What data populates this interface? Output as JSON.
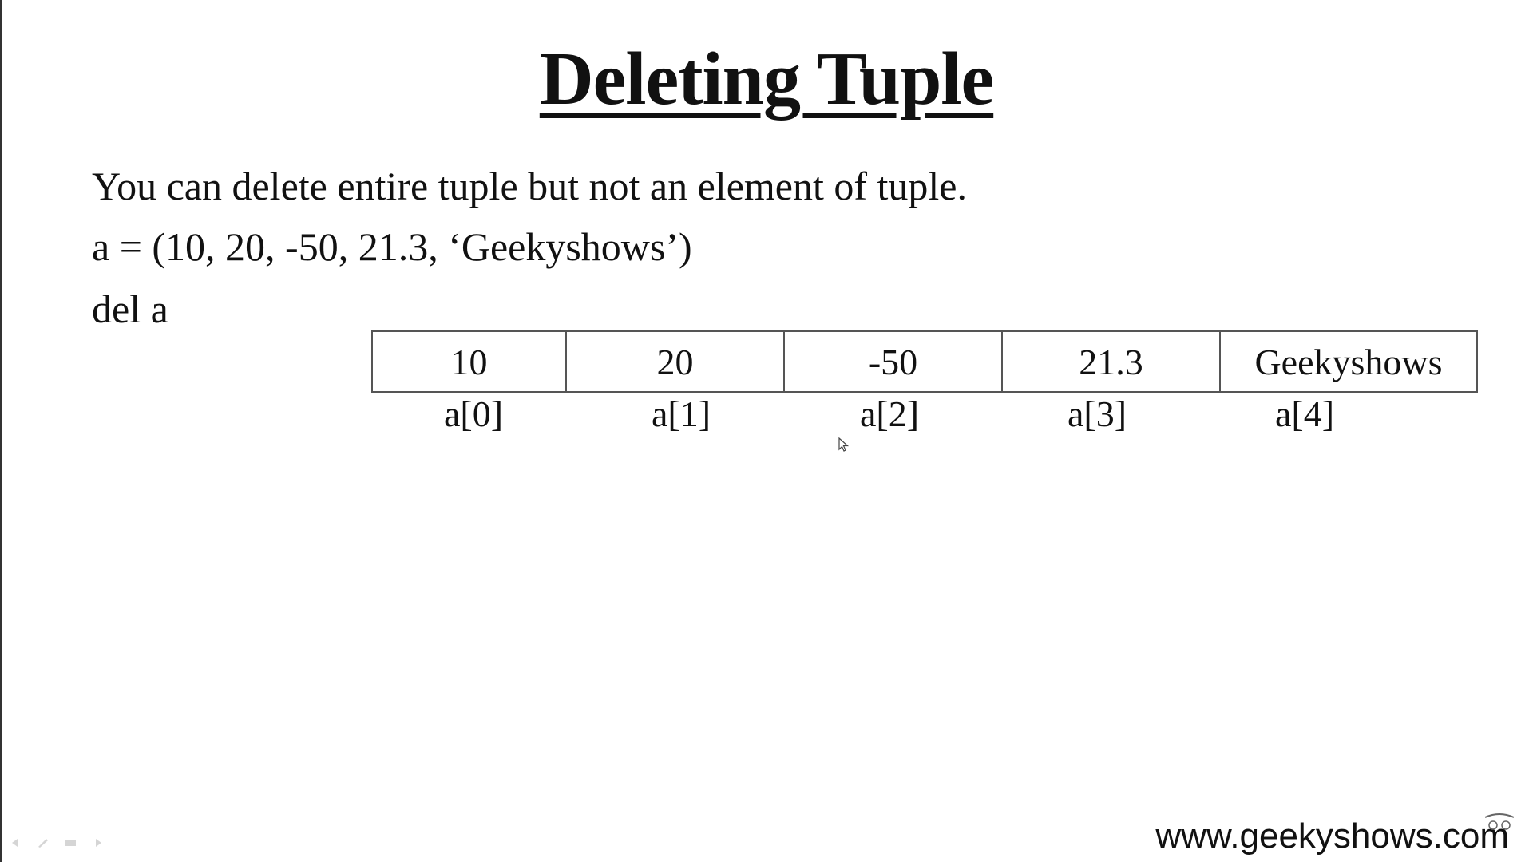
{
  "slide": {
    "title": "Deleting Tuple",
    "lines": [
      "You can delete entire tuple but not an element of tuple.",
      "a = (10, 20, -50, 21.3, ‘Geekyshows’)",
      "del a"
    ],
    "tuple_values": [
      "10",
      "20",
      "-50",
      "21.3",
      "Geekyshows"
    ],
    "indices": [
      "a[0]",
      "a[1]",
      "a[2]",
      "a[3]",
      "a[4]"
    ],
    "footer_url": "www.geekyshows.com"
  },
  "icons": {
    "cursor": "mouse-pointer-icon",
    "controls": [
      "previous-arrow-icon",
      "pen-icon",
      "slides-menu-icon",
      "next-arrow-icon"
    ],
    "corner": "channel-logo-icon"
  }
}
